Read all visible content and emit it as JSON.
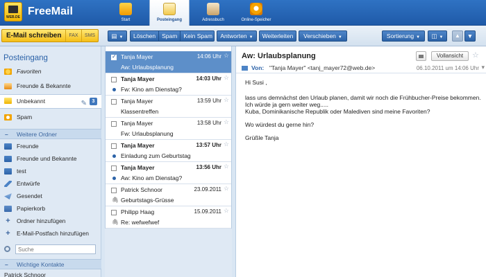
{
  "app": {
    "title": "FreeMail",
    "logo_text": "WEB.DE"
  },
  "topnav": [
    {
      "label": "Start",
      "icon": "home-icon"
    },
    {
      "label": "Posteingang",
      "icon": "envelope-icon",
      "active": true
    },
    {
      "label": "Adressbuch",
      "icon": "address-book-icon"
    },
    {
      "label": "Online-Speicher",
      "icon": "cloud-storage-icon"
    }
  ],
  "compose": {
    "label": "E-Mail schreiben",
    "fax": "FAX",
    "sms": "SMS"
  },
  "toolbar": {
    "loeschen": "Löschen",
    "spam": "Spam",
    "kein_spam": "Kein Spam",
    "antworten": "Antworten",
    "weiterleiten": "Weiterleiten",
    "verschieben": "Verschieben",
    "sortierung": "Sortierung"
  },
  "sidebar": {
    "heading": "Posteingang",
    "items": [
      {
        "label": "Favoriten"
      },
      {
        "label": "Freunde & Bekannte"
      },
      {
        "label": "Unbekannt",
        "badge": "3"
      },
      {
        "label": "Spam"
      }
    ],
    "more_folders_title": "Weitere Ordner",
    "folders": [
      {
        "label": "Freunde"
      },
      {
        "label": "Freunde und Bekannte"
      },
      {
        "label": "test"
      },
      {
        "label": "Entwürfe"
      },
      {
        "label": "Gesendet"
      },
      {
        "label": "Papierkorb"
      },
      {
        "label": "Ordner hinzufügen"
      },
      {
        "label": "E-Mail-Postfach hinzufügen"
      }
    ],
    "search_placeholder": "Suche",
    "contacts_title": "Wichtige Kontakte",
    "contact_first": "Patrick Schnoor"
  },
  "messages": [
    {
      "sender": "Tanja Mayer",
      "time": "14:06 Uhr",
      "subject": "Aw: Urlaubsplanung",
      "selected": true,
      "unread": false,
      "marker": "none"
    },
    {
      "sender": "Tanja Mayer",
      "time": "14:03 Uhr",
      "subject": "Fw: Kino am Dienstag?",
      "selected": false,
      "unread": true,
      "marker": "dot"
    },
    {
      "sender": "Tanja Mayer",
      "time": "13:59 Uhr",
      "subject": "Klassentreffen",
      "selected": false,
      "unread": false,
      "marker": "none"
    },
    {
      "sender": "Tanja Mayer",
      "time": "13:58 Uhr",
      "subject": "Fw: Urlaubsplanung",
      "selected": false,
      "unread": false,
      "marker": "none"
    },
    {
      "sender": "Tanja Mayer",
      "time": "13:57 Uhr",
      "subject": "Einladung zum Geburtstag",
      "selected": false,
      "unread": true,
      "marker": "dot"
    },
    {
      "sender": "Tanja Mayer",
      "time": "13:56 Uhr",
      "subject": "Aw: Kino am Dienstag?",
      "selected": false,
      "unread": true,
      "marker": "dot"
    },
    {
      "sender": "Patrick Schnoor",
      "time": "23.09.2011",
      "subject": "Geburtstags-Grüsse",
      "selected": false,
      "unread": false,
      "marker": "clip"
    },
    {
      "sender": "Philipp Haag",
      "time": "15.09.2011",
      "subject": "Re: wefwefwef",
      "selected": false,
      "unread": false,
      "marker": "clip"
    }
  ],
  "reader": {
    "subject": "Aw: Urlaubsplanung",
    "fullview_label": "Vollansicht",
    "from_label": "Von:",
    "from": "\"Tanja Mayer\" <tanj_mayer72@web.de>",
    "date": "06.10.2011 um 14:06 Uhr",
    "body": [
      "Hi Susi ,",
      "lass uns demnächst den Urlaub planen, damit wir noch die Frühbucher-Preise bekommen.",
      "Ich würde ja gern weiter weg.....",
      "Kuba, Dominikanische Republik oder Malediven sind meine Favoriten?",
      "Wo würdest du gerne hin?",
      "Grüßle Tanja"
    ]
  },
  "colors": {
    "topbar": "#2f72c3",
    "compose_button": "#f5bf17",
    "selected_row": "#5d8fc9",
    "toolbar_button": "#2c63a8"
  }
}
